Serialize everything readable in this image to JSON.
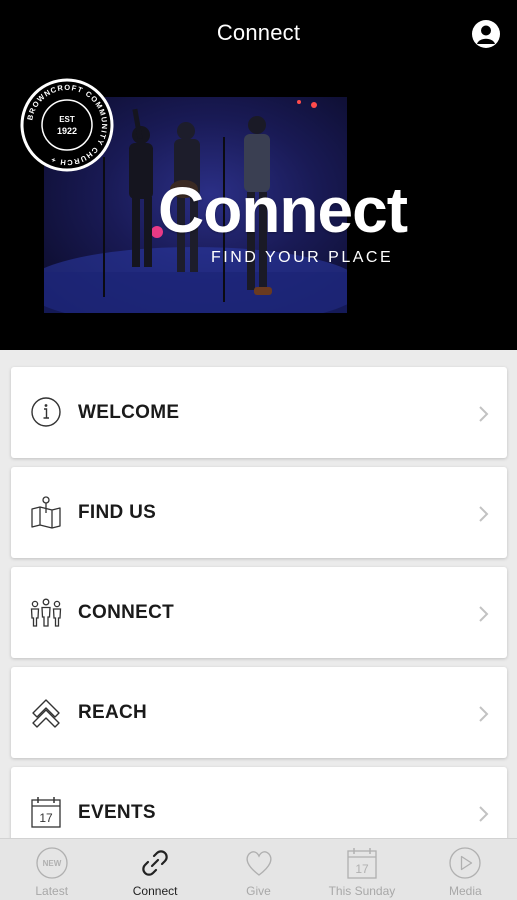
{
  "header": {
    "title": "Connect",
    "profile_icon": "user-circle-icon"
  },
  "hero": {
    "title": "Connect",
    "subtitle": "FIND YOUR PLACE",
    "logo": {
      "ring_text": "BROWNCROFT COMMUNITY CHURCH +",
      "est": "EST",
      "year": "1922"
    }
  },
  "menu": {
    "items": [
      {
        "label": "WELCOME",
        "icon": "info-icon"
      },
      {
        "label": "FIND US",
        "icon": "map-pin-icon"
      },
      {
        "label": "CONNECT",
        "icon": "people-icon"
      },
      {
        "label": "REACH",
        "icon": "double-chevron-up-icon"
      },
      {
        "label": "EVENTS",
        "icon": "calendar-icon",
        "icon_text": "17"
      }
    ]
  },
  "tabbar": {
    "tabs": [
      {
        "label": "Latest",
        "icon": "new-badge-icon",
        "icon_text": "NEW",
        "active": false
      },
      {
        "label": "Connect",
        "icon": "link-icon",
        "active": true
      },
      {
        "label": "Give",
        "icon": "heart-icon",
        "active": false
      },
      {
        "label": "This Sunday",
        "icon": "calendar-icon",
        "icon_text": "17",
        "active": false
      },
      {
        "label": "Media",
        "icon": "play-icon",
        "active": false
      }
    ]
  },
  "colors": {
    "header_bg": "#000000",
    "list_bg": "#ebebeb",
    "tab_inactive": "#a8a8a8",
    "tab_active": "#222222"
  }
}
